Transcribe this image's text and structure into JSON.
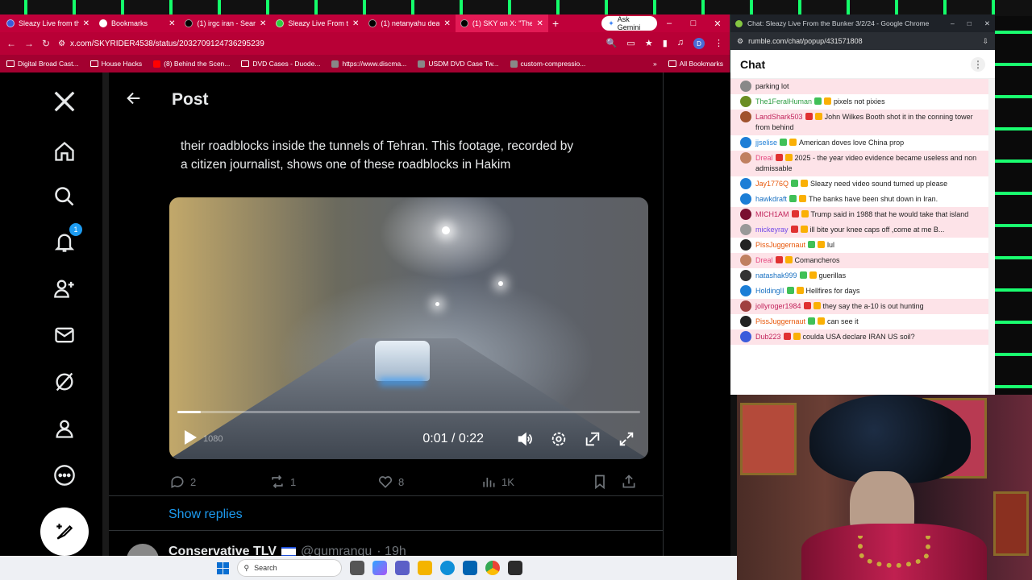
{
  "browser": {
    "tabs": [
      {
        "title": "Sleazy Live from the",
        "color": "#3b5bdb"
      },
      {
        "title": "Bookmarks",
        "color": "#ffffff"
      },
      {
        "title": "(1) irgc iran - Sear",
        "color": "#000000"
      },
      {
        "title": "Sleazy Live From th",
        "color": "#2ecc40"
      },
      {
        "title": "(1) netanyahu dea",
        "color": "#000000"
      },
      {
        "title": "(1) SKY on X: \"The",
        "color": "#000000",
        "active": true
      }
    ],
    "ask_gemini": "Ask Gemini",
    "url": "x.com/SKYRIDER4538/status/2032709124736295239",
    "bookmarks": [
      {
        "label": "Digital Broad Cast...",
        "type": "folder"
      },
      {
        "label": "House Hacks",
        "type": "folder"
      },
      {
        "label": "(8) Behind the Scen...",
        "type": "youtube"
      },
      {
        "label": "DVD Cases - Duode...",
        "type": "folder"
      },
      {
        "label": "https://www.discma...",
        "type": "site"
      },
      {
        "label": "USDM DVD Case Tw...",
        "type": "site"
      },
      {
        "label": "custom-compressio...",
        "type": "site"
      }
    ],
    "all_bookmarks": "All Bookmarks"
  },
  "x": {
    "header_title": "Post",
    "notifications_count": "1",
    "tweet_text_line1": "their roadblocks inside the tunnels of Tehran. This footage, recorded by",
    "tweet_text_line2": "a citizen journalist, shows one of these roadblocks in Hakim",
    "video": {
      "time": "0:01 / 0:22",
      "quality": "1080",
      "progress": 0.05
    },
    "actions": {
      "replies": "2",
      "reposts": "1",
      "likes": "8",
      "views": "1K"
    },
    "show_replies": "Show replies",
    "next_post": {
      "name": "Conservative TLV",
      "handle": "@qumranqu",
      "time": "· 19h"
    }
  },
  "taskbar": {
    "search_placeholder": "Search"
  },
  "chat": {
    "window_title": "Chat: Sleazy Live From the Bunker 3/2/24 - Google Chrome",
    "url": "rumble.com/chat/popup/431571808",
    "heading": "Chat",
    "messages": [
      {
        "user": "",
        "text": "parking lot",
        "color": "#c0392b",
        "avatar": "#888888",
        "hl": true
      },
      {
        "user": "The1FeralHuman",
        "text": "pixels not pixies",
        "color": "#2f9e44",
        "avatar": "#6b8e23",
        "hl": false
      },
      {
        "user": "LandShark503",
        "text": "John Wilkes Booth shot it in the conning tower from behind",
        "color": "#c2255c",
        "avatar": "#a0522d",
        "hl": true
      },
      {
        "user": "jjselise",
        "text": "American doves love China prop",
        "color": "#1c7ed6",
        "avatar": "#1c7ed6",
        "hl": false
      },
      {
        "user": "Dreal",
        "text": "2025 - the year video evidence became useless and non admissable",
        "color": "#e64980",
        "avatar": "#c08060",
        "hl": true
      },
      {
        "user": "Jay1776Q",
        "text": "Sleazy need video sound turned up please",
        "color": "#e8590c",
        "avatar": "#1c7ed6",
        "hl": false
      },
      {
        "user": "hawkdraft",
        "text": "The banks have been shut down in Iran.",
        "color": "#1971c2",
        "avatar": "#1c7ed6",
        "hl": false
      },
      {
        "user": "MICH1AM",
        "text": "Trump said in 1988 that he would take that island",
        "color": "#c2255c",
        "avatar": "#7a1030",
        "hl": true
      },
      {
        "user": "mickeyray",
        "text": "ill bite your knee caps off ,come at me B...",
        "color": "#7048e8",
        "avatar": "#999999",
        "hl": true
      },
      {
        "user": "PissJuggernaut",
        "text": "lul",
        "color": "#e8590c",
        "avatar": "#222222",
        "hl": false
      },
      {
        "user": "Dreal",
        "text": "Comancheros",
        "color": "#e64980",
        "avatar": "#c08060",
        "hl": true
      },
      {
        "user": "natashak999",
        "text": "guerillas",
        "color": "#1971c2",
        "avatar": "#333333",
        "hl": false
      },
      {
        "user": "HoldingII",
        "text": "Hellfires for days",
        "color": "#1971c2",
        "avatar": "#1c7ed6",
        "hl": false
      },
      {
        "user": "jollyroger1984",
        "text": "they say the a-10 is out hunting",
        "color": "#c2255c",
        "avatar": "#a04040",
        "hl": true
      },
      {
        "user": "PissJuggernaut",
        "text": "can see it",
        "color": "#e8590c",
        "avatar": "#222222",
        "hl": false
      },
      {
        "user": "Dub223",
        "text": "coulda USA declare IRAN US soil?",
        "color": "#c2255c",
        "avatar": "#3b5bdb",
        "hl": true
      }
    ]
  }
}
